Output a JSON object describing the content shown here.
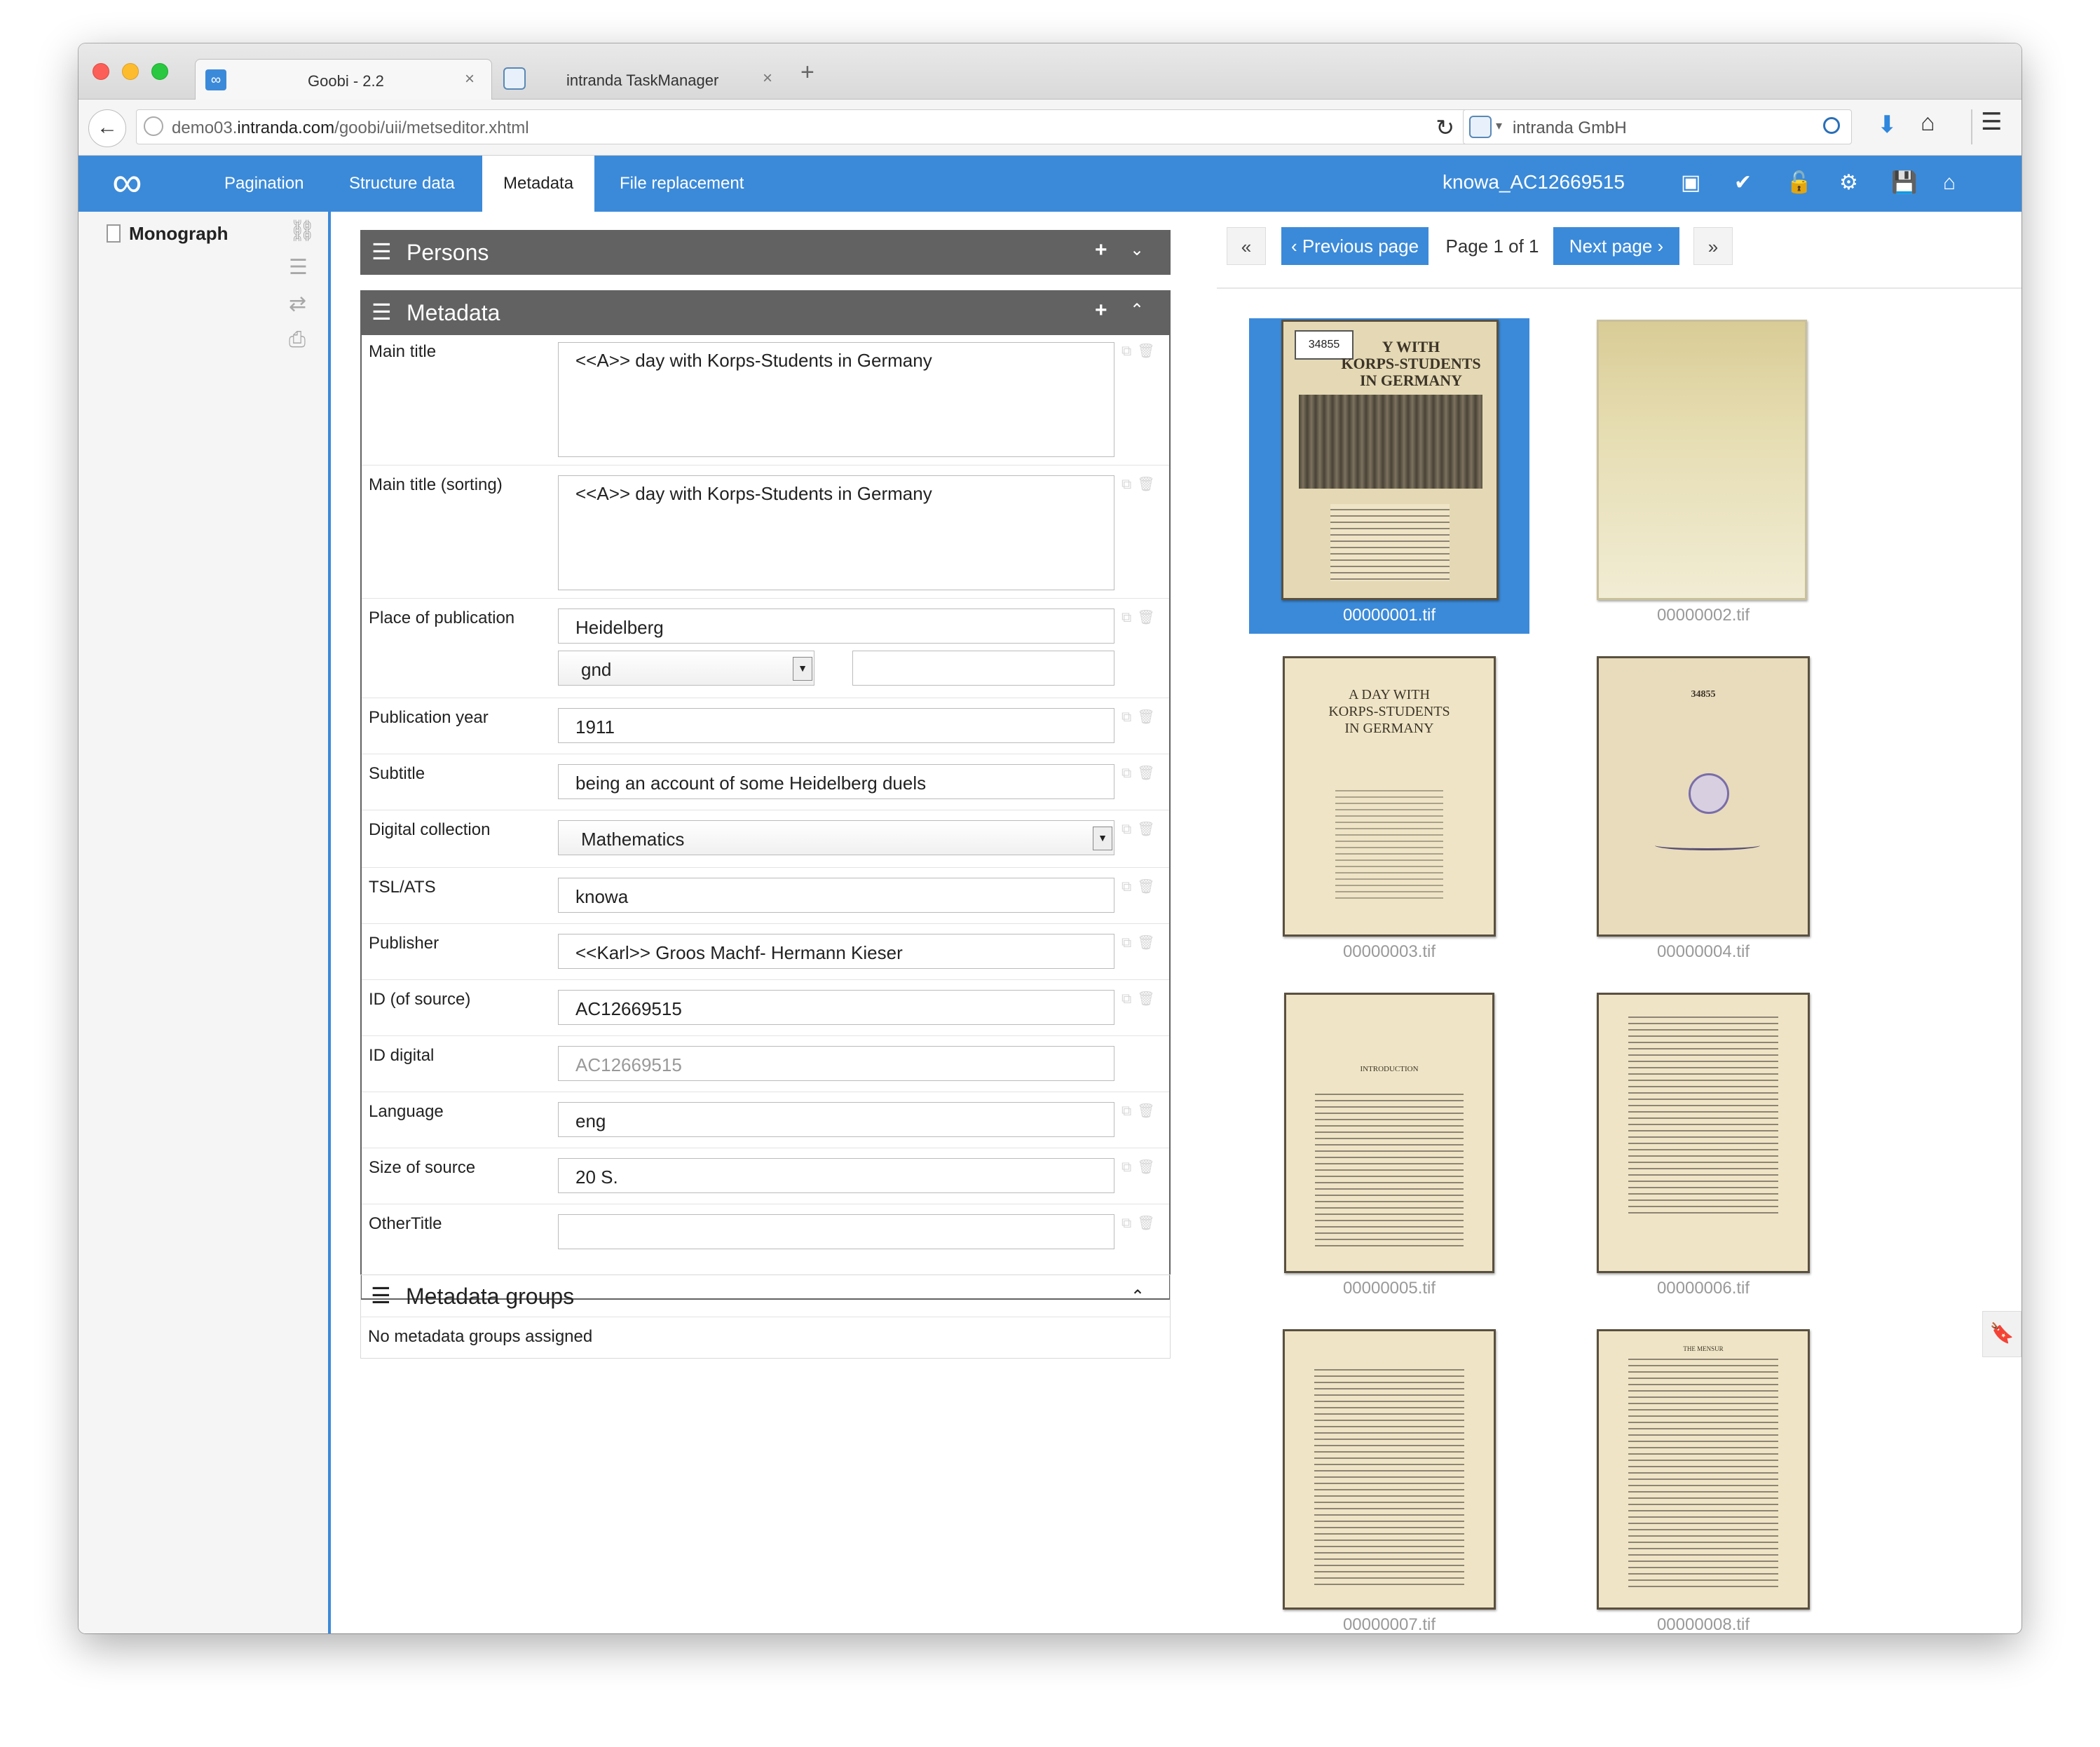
{
  "browser": {
    "tabs": [
      {
        "label": "Goobi - 2.2",
        "close": "×",
        "icon": "goobi-icon"
      },
      {
        "label": "intranda TaskManager",
        "close": "×",
        "icon": "intranda-icon"
      }
    ],
    "new_tab": "+",
    "url_prefix": "demo03.",
    "url_host": "intranda.com",
    "url_path": "/goobi/uii/metseditor.xhtml",
    "search_text": "intranda GmbH",
    "search_arrow": "▾"
  },
  "app": {
    "logo": "∞",
    "tabs": [
      "Pagination",
      "Structure data",
      "Metadata",
      "File replacement"
    ],
    "active_tab": "Metadata",
    "record_id": "knowa_AC12669515",
    "accent": "#3b8ad9"
  },
  "tree": {
    "root": "Monograph"
  },
  "persons": {
    "title": "Persons",
    "plus": "+",
    "chev": "⌄"
  },
  "metadata": {
    "title": "Metadata",
    "plus": "+",
    "chev": "⌃",
    "rows": [
      {
        "label": "Main title",
        "value": "<<A>> day with Korps-Students in Germany"
      },
      {
        "label": "Main title (sorting)",
        "value": "<<A>> day with Korps-Students in Germany"
      },
      {
        "label": "Place of publication",
        "value": "Heidelberg",
        "authority": "gnd",
        "authority_value": ""
      },
      {
        "label": "Publication year",
        "value": "1911"
      },
      {
        "label": "Subtitle",
        "value": "being an account of some Heidelberg duels"
      },
      {
        "label": "Digital collection",
        "value": "Mathematics"
      },
      {
        "label": "TSL/ATS",
        "value": "knowa"
      },
      {
        "label": "Publisher",
        "value": "<<Karl>> Groos Machf- Hermann Kieser"
      },
      {
        "label": "ID (of source)",
        "value": "AC12669515"
      },
      {
        "label": "ID digital",
        "value": "AC12669515"
      },
      {
        "label": "Language",
        "value": "eng"
      },
      {
        "label": "Size of source",
        "value": "20 S."
      },
      {
        "label": "OtherTitle",
        "value": ""
      }
    ]
  },
  "metadata_groups": {
    "title": "Metadata groups",
    "chev": "⌃",
    "empty": "No metadata groups assigned"
  },
  "pager": {
    "first": "«",
    "prev": "‹ Previous page",
    "status": "Page 1 of 1",
    "next": "Next page ›",
    "last": "»"
  },
  "images": [
    {
      "file": "00000001.tif",
      "selected": true,
      "cover_title": "Y WITH\nKORPS-STUDENTS\nIN GERMANY",
      "stamp": "34855"
    },
    {
      "file": "00000002.tif"
    },
    {
      "file": "00000003.tif",
      "page_title": "A DAY WITH\nKORPS-STUDENTS\nIN GERMANY"
    },
    {
      "file": "00000004.tif",
      "number": "34855"
    },
    {
      "file": "00000005.tif",
      "heading": "INTRODUCTION"
    },
    {
      "file": "00000006.tif"
    },
    {
      "file": "00000007.tif"
    },
    {
      "file": "00000008.tif",
      "heading": "THE MENSUR"
    }
  ]
}
